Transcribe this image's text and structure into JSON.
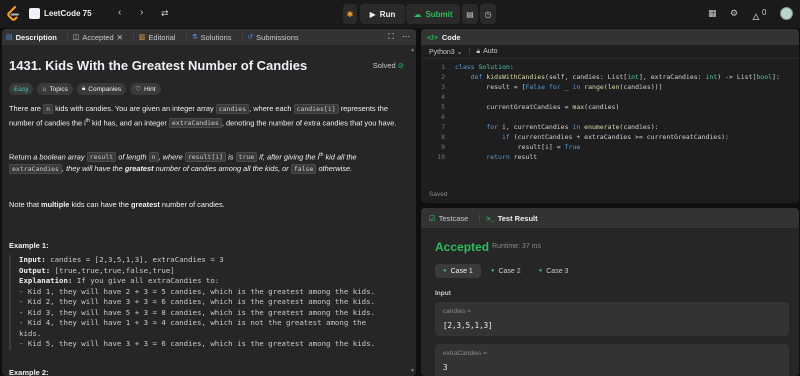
{
  "topbar": {
    "list_title": "LeetCode 75",
    "run_label": "Run",
    "submit_label": "Submit",
    "coin_count": "0"
  },
  "left_tabs": [
    {
      "label": "Description"
    },
    {
      "label": "Accepted"
    },
    {
      "label": "Editorial"
    },
    {
      "label": "Solutions"
    },
    {
      "label": "Submissions"
    }
  ],
  "problem": {
    "title": "1431. Kids With the Greatest Number of Candies",
    "status": "Solved",
    "tags": [
      "Easy",
      "Topics",
      "Companies",
      "Hint"
    ],
    "p1_a": "There are ",
    "p1_n": "n",
    "p1_b": " kids with candies. You are given an integer array ",
    "p1_candies": "candies",
    "p1_c": ", where each ",
    "p1_candies_i": "candies[i]",
    "p1_d": " represents the number of candies the i",
    "p1_th": "th",
    "p1_e": " kid has, and an integer ",
    "p1_extra": "extraCandies",
    "p1_f": ", denoting the number of extra candies that you have.",
    "p2_a": "Return ",
    "p2_b": "a boolean array ",
    "p2_result": "result",
    "p2_c": " of length ",
    "p2_n": "n",
    "p2_d": ", where ",
    "p2_result_i": "result[i]",
    "p2_e": " is ",
    "p2_true": "true",
    "p2_f": " if, after giving the i",
    "p2_th": "th",
    "p2_g": " kid all the ",
    "p2_extra": "extraCandies",
    "p2_h": ", they will have the ",
    "p2_greatest": "greatest",
    "p2_i": " number of candies among all the kids, or ",
    "p2_false": "false",
    "p2_j": " otherwise.",
    "p3_a": "Note that ",
    "p3_multiple": "multiple",
    "p3_b": " kids can have the ",
    "p3_greatest": "greatest",
    "p3_c": " number of candies.",
    "example1_title": "Example 1:",
    "example2_title": "Example 2:",
    "example1": {
      "input_label": "Input:",
      "input_val": " candies = [2,3,5,1,3], extraCandies = 3",
      "output_label": "Output:",
      "output_val": " [true,true,true,false,true]",
      "expl_label": "Explanation:",
      "expl_val": " If you give all extraCandies to:",
      "lines": [
        "- Kid 1, they will have 2 + 3 = 5 candies, which is the greatest among the kids.",
        "- Kid 2, they will have 3 + 3 = 6 candies, which is the greatest among the kids.",
        "- Kid 3, they will have 5 + 3 = 8 candies, which is the greatest among the kids.",
        "- Kid 4, they will have 1 + 3 = 4 candies, which is not the greatest among the",
        "kids.",
        "- Kid 5, they will have 3 + 3 = 6 candies, which is the greatest among the kids."
      ]
    }
  },
  "code": {
    "header": "Code",
    "language": "Python3",
    "mode": "Auto",
    "saved": "Saved",
    "line_numbers": [
      "1",
      "2",
      "3",
      "4",
      "5",
      "6",
      "7",
      "8",
      "9",
      "10"
    ]
  },
  "result": {
    "tab_testcase": "Testcase",
    "tab_result": "Test Result",
    "status": "Accepted",
    "runtime": "Runtime: 37 ms",
    "cases": [
      "Case 1",
      "Case 2",
      "Case 3"
    ],
    "input_label": "Input",
    "fields": [
      {
        "name": "candies =",
        "value": "[2,3,5,1,3]"
      },
      {
        "name": "extraCandies =",
        "value": "3"
      }
    ]
  },
  "colors": {
    "accent_green": "#2cbb5d",
    "easy_teal": "#46c6c2",
    "background": "#0f0f0f",
    "panel": "#262626"
  },
  "icons": [
    "leetcode-logo",
    "list-icon",
    "chevron-left-icon",
    "chevron-right-icon",
    "shuffle-icon",
    "play-icon",
    "cloud-upload-icon",
    "notes-icon",
    "timer-icon",
    "grid-icon",
    "gear-icon",
    "fire-icon",
    "avatar"
  ]
}
